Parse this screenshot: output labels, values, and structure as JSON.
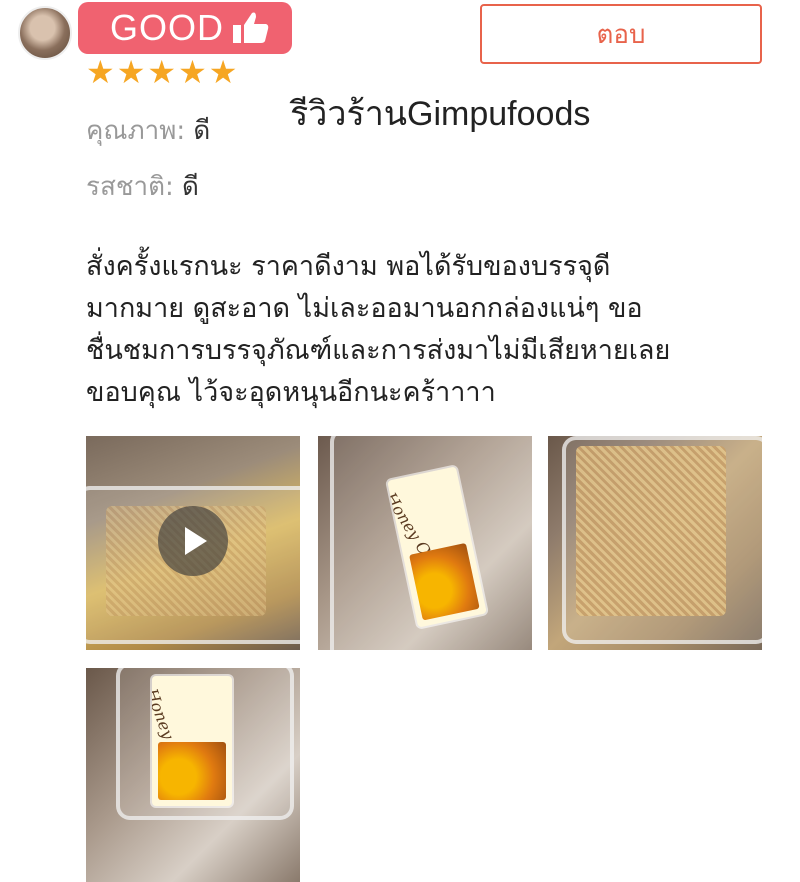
{
  "header": {
    "badge_text": "GOOD",
    "reply_label": "ตอบ"
  },
  "rating": {
    "stars": 5,
    "max_stars": 5,
    "star_color": "#f6a623"
  },
  "watermark": "รีวิวร้านGimpufoods",
  "attributes": [
    {
      "label": "คุณภาพ:",
      "value": "ดี"
    },
    {
      "label": "รสชาติ:",
      "value": "ดี"
    }
  ],
  "review_lines": [
    "สั่งครั้งแรกนะ  ราคาดีงาม  พอได้รับของบรรจุดี",
    "มากมาย  ดูสะอาด  ไม่เละออมานอกกล่องแน่ๆ  ขอ",
    "ชื่นชมการบรรจุภัณฑ์และการส่งมาไม่มีเสียหายเลย",
    "ขอบคุณ  ไว้จะอุดหนุนอีกนะคร้าาาา"
  ],
  "photos": [
    {
      "kind": "video",
      "icon": "play-icon"
    },
    {
      "kind": "image",
      "product_label": "Honey Comb"
    },
    {
      "kind": "image"
    },
    {
      "kind": "image",
      "product_label": "Honey Comb"
    }
  ],
  "colors": {
    "badge": "#f06270",
    "reply_accent": "#e8634b"
  }
}
